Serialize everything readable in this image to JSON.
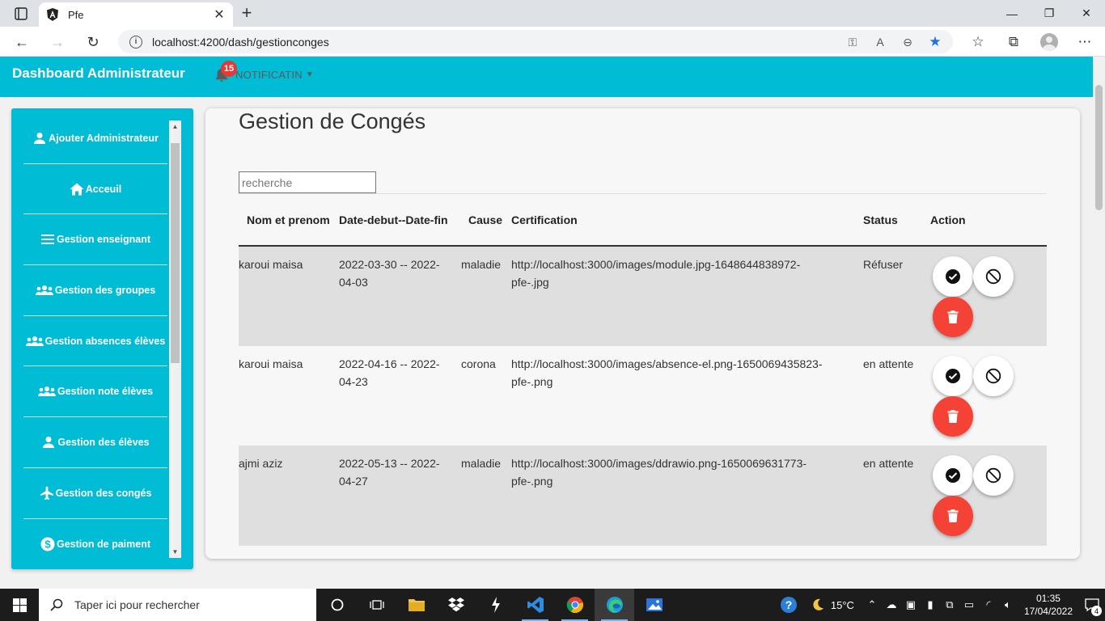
{
  "browser": {
    "tab_title": "Pfe",
    "url": "localhost:4200/dash/gestionconges"
  },
  "header": {
    "brand": "Dashboard Administrateur",
    "notification_count": "15",
    "notification_label": "NOTIFICATIN"
  },
  "sidebar": {
    "items": [
      {
        "label": "Ajouter Administrateur",
        "icon": "person-icon"
      },
      {
        "label": "Acceuil",
        "icon": "home-icon"
      },
      {
        "label": "Gestion enseignant",
        "icon": "menu-icon"
      },
      {
        "label": "Gestion des groupes",
        "icon": "group-icon"
      },
      {
        "label": "Gestion absences élèves",
        "icon": "group-icon"
      },
      {
        "label": "Gestion note élèves",
        "icon": "group-icon"
      },
      {
        "label": "Gestion des élèves",
        "icon": "person-icon"
      },
      {
        "label": "Gestion des congés",
        "icon": "airplane-icon"
      },
      {
        "label": "Gestion de paiment",
        "icon": "dollar-icon"
      }
    ]
  },
  "main": {
    "title": "Gestion de Congés",
    "search_placeholder": "recherche",
    "columns": [
      "Nom et prenom",
      "Date-debut--Date-fin",
      "Cause",
      "Certification",
      "Status",
      "Action"
    ],
    "rows": [
      {
        "name": "karoui maisa",
        "dates": "2022-03-30 -- 2022-04-03",
        "cause": "maladie",
        "certification": "http://localhost:3000/images/module.jpg-1648644838972-pfe-.jpg",
        "status": "Réfuser"
      },
      {
        "name": "karoui maisa",
        "dates": "2022-04-16 -- 2022-04-23",
        "cause": "corona",
        "certification": "http://localhost:3000/images/absence-el.png-1650069435823-pfe-.png",
        "status": "en attente"
      },
      {
        "name": "ajmi aziz",
        "dates": "2022-05-13 -- 2022-04-27",
        "cause": "maladie",
        "certification": "http://localhost:3000/images/ddrawio.png-1650069631773-pfe-.png",
        "status": "en attente"
      }
    ]
  },
  "taskbar": {
    "search_placeholder": "Taper ici pour rechercher",
    "temperature": "15°C",
    "time": "01:35",
    "date": "17/04/2022",
    "notification_count": "4"
  },
  "colors": {
    "primary": "#00bcd4",
    "danger": "#f44336",
    "badge": "#e53935"
  }
}
